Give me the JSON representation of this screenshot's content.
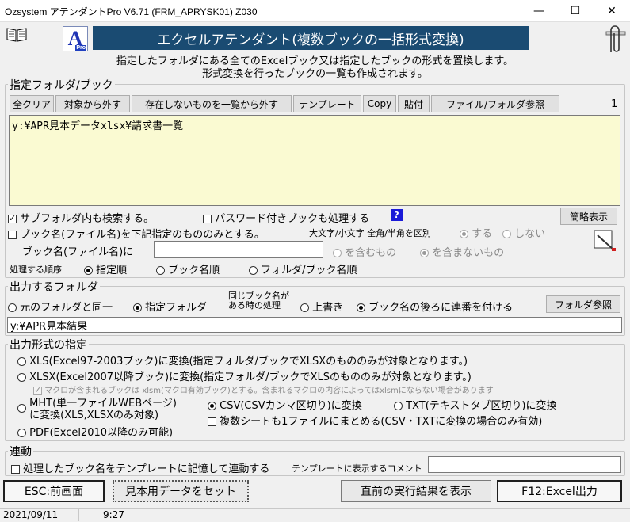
{
  "window": {
    "title": "Ozsystem アテンダントPro V6.71 (FRM_APRYSK01) Z030",
    "minimize": "—",
    "maximize": "☐",
    "close": "✕"
  },
  "header": {
    "banner": "エクセルアテンダント(複数ブックの一括形式変換)",
    "logo": "A",
    "logo_sub": "Pro",
    "desc1": "指定したフォルダにある全てのExcelブック又は指定したブックの形式を置換します。",
    "desc2": "形式変換を行ったブックの一覧も作成されます。"
  },
  "folder_group": {
    "title": "指定フォルダ/ブック",
    "buttons": [
      "全クリア",
      "対象から外す",
      "存在しないものを一覧から外す",
      "テンプレート",
      "Copy",
      "貼付",
      "ファイル/フォルダ参照"
    ],
    "count": "1",
    "list": "y:¥APR見本データxlsx¥請求書一覧",
    "subfolder": "サブフォルダ内も検索する。",
    "password": "パスワード付きブックも処理する",
    "help": "?",
    "simple_btn": "簡略表示",
    "bookname_only": "ブック名(ファイル名)を下記指定のもののみとする。",
    "case_label": "大文字/小文字 全角/半角を区別",
    "case_yes": "する",
    "case_no": "しない",
    "bookname_label": "ブック名(ファイル名)に",
    "bookname_value": "",
    "include": "を含むもの",
    "exclude": "を含まないもの",
    "order_label": "処理する順序",
    "order_opts": [
      "指定順",
      "ブック名順",
      "フォルダ/ブック名順"
    ]
  },
  "output_group": {
    "title": "出力するフォルダ",
    "same": "元のフォルダと同一",
    "specified": "指定フォルダ",
    "dup_label1": "同じブック名が",
    "dup_label2": "ある時の処理",
    "overwrite": "上書き",
    "serial": "ブック名の後ろに連番を付ける",
    "ref_btn": "フォルダ参照",
    "path": "y:¥APR見本結果"
  },
  "format_group": {
    "title": "出力形式の指定",
    "xls": "XLS(Excel97-2003ブック)に変換(指定フォルダ/ブックでXLSXのもののみが対象となります。)",
    "xlsx": "XLSX(Excel2007以降ブック)に変換(指定フォルダ/ブックでXLSのもののみが対象となります。)",
    "macro": "マクロが含まれるブックは xlsm(マクロ有効ブック)とする。含まれるマクロの内容によってはxlsmにならない場合があります",
    "mht1": "MHT(単一ファイルWEBページ)",
    "mht2": "に変換(XLS,XLSXのみ対象)",
    "csv": "CSV(CSVカンマ区切り)に変換",
    "tsv": "TXT(テキストタブ区切り)に変換",
    "multi": "複数シートも1ファイルにまとめる(CSV・TXTに変換の場合のみ有効)",
    "pdf": "PDF(Excel2010以降のみ可能)"
  },
  "link_group": {
    "title": "連動",
    "remember": "処理したブック名をテンプレートに記憶して連動する",
    "comment_label": "テンプレートに表示するコメント",
    "comment_value": ""
  },
  "footer": {
    "esc": "ESC:前画面",
    "sample": "見本用データをセット",
    "last": "直前の実行結果を表示",
    "f12": "F12:Excel出力"
  },
  "status": {
    "date": "2021/09/11",
    "time": "9:27"
  },
  "icons": {
    "book": "book-icon",
    "clip": "paperclip-icon",
    "pencil": "edit-icon"
  }
}
